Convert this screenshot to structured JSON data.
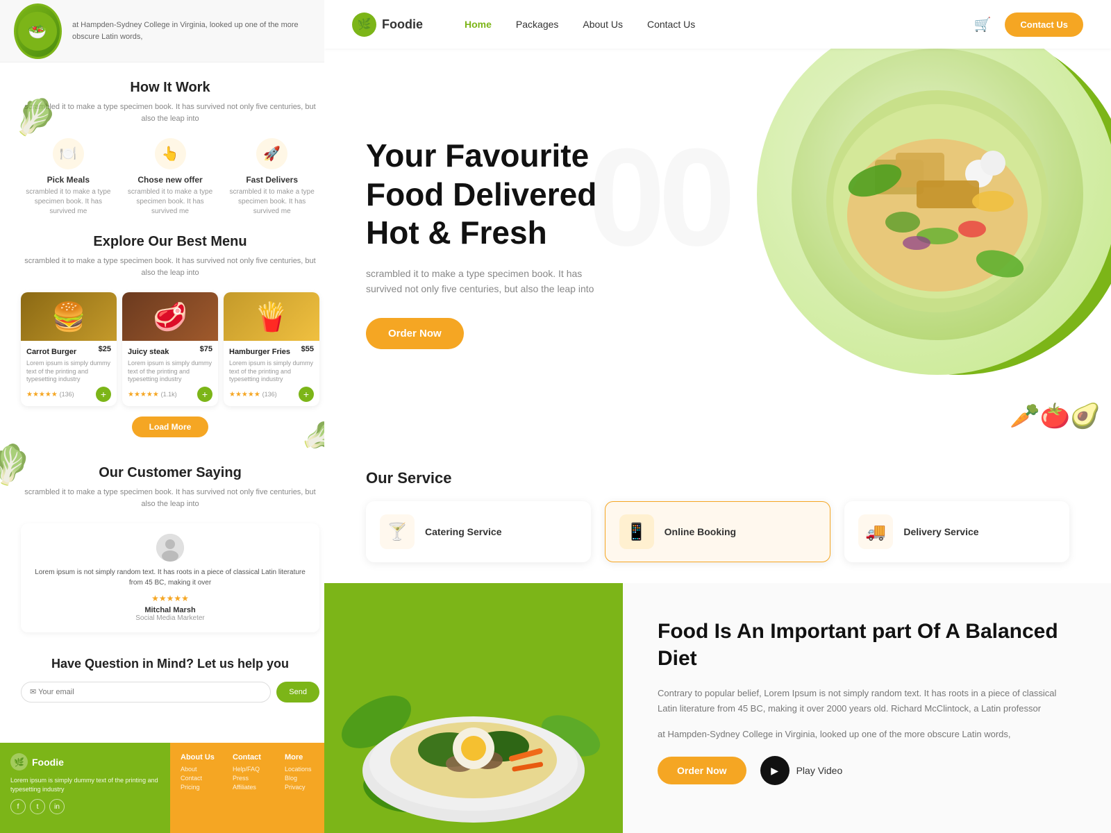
{
  "leftPanel": {
    "topText": "at Hampden-Sydney College in Virginia, looked up one of the more obscure Latin words,",
    "howItWork": {
      "title": "How It Work",
      "subtitle": "scrambled it to make a type specimen book. It has survived not only five centuries, but also the leap into",
      "steps": [
        {
          "icon": "🍽️",
          "label": "Pick Meals",
          "desc": "scrambled it to make a type specimen book. It has survived me"
        },
        {
          "icon": "👆",
          "label": "Chose new offer",
          "desc": "scrambled it to make a type specimen book. It has survived me"
        },
        {
          "icon": "🚀",
          "label": "Fast Delivers",
          "desc": "scrambled it to make a type specimen book. It has survived me"
        }
      ]
    },
    "exploreMenu": {
      "title": "Explore Our Best Menu",
      "subtitle": "scrambled it to make a type specimen book. It has survived not only five centuries, but also the leap into",
      "items": [
        {
          "name": "Carrot Burger",
          "price": "$25",
          "desc": "Lorem ipsum is simply dummy text of the printing and typesetting industry",
          "stars": "★★★★★",
          "rating": "(136)"
        },
        {
          "name": "Juicy steak",
          "price": "$75",
          "desc": "Lorem ipsum is simply dummy text of the printing and typesetting industry",
          "stars": "★★★★★",
          "rating": "(1.1k)"
        },
        {
          "name": "Hamburger Fries",
          "price": "$55",
          "desc": "Lorem ipsum is simply dummy text of the printing and typesetting industry",
          "stars": "★★★★★",
          "rating": "(136)"
        }
      ],
      "loadMore": "Load More"
    },
    "testimonial": {
      "title": "Our Customer Saying",
      "subtitle": "scrambled it to make a type specimen book. It has survived not only five centuries, but also the leap into",
      "review": "Lorem ipsum is not simply random text. It has roots in a piece of classical Latin literature from 45 BC, making it over",
      "stars": "★★★★★",
      "name": "Mitchal Marsh",
      "role": "Social Media Marketer"
    },
    "contact": {
      "title": "Have Question in Mind? Let us help you",
      "placeholder": "✉ Your email",
      "sendLabel": "Send"
    },
    "footer": {
      "logoText": "Foodie",
      "desc": "Lorem ipsum is simply dummy text of the printing and typesetting industry",
      "cols": [
        {
          "title": "About Us",
          "items": [
            "About",
            "Contact",
            "Pricing"
          ]
        },
        {
          "title": "Contact",
          "items": [
            "Help/FAQ",
            "Press",
            "Affiliates"
          ]
        },
        {
          "title": "More",
          "items": [
            "Locations",
            "Blog",
            "Privacy"
          ]
        }
      ]
    }
  },
  "rightPanel": {
    "navbar": {
      "logoText": "Foodie",
      "links": [
        "Home",
        "Packages",
        "About Us",
        "Contact Us"
      ],
      "activeLink": "Home",
      "contactBtn": "Contact Us"
    },
    "hero": {
      "title": "Your Favourite Food Delivered Hot & Fresh",
      "subtitle": "scrambled it to make a type specimen book. It has survived not only five centuries, but also the leap into",
      "orderBtn": "Order Now",
      "watermark": "00"
    },
    "services": {
      "title": "Our Service",
      "items": [
        {
          "icon": "🍸",
          "label": "Catering Service",
          "active": false
        },
        {
          "icon": "📱",
          "label": "Online Booking",
          "active": true
        },
        {
          "icon": "🚚",
          "label": "Delivery Service",
          "active": false
        }
      ]
    },
    "bottom": {
      "title": "Food Is An Important part Of A Balanced Diet",
      "text1": "Contrary to popular belief, Lorem Ipsum is not simply random text. It has roots in a piece of classical Latin literature from 45 BC, making it over 2000 years old. Richard McClintock, a Latin professor",
      "text2": "at Hampden-Sydney College in Virginia, looked up one of the more obscure Latin words,",
      "orderBtn": "Order Now",
      "playBtn": "Play Video"
    }
  }
}
